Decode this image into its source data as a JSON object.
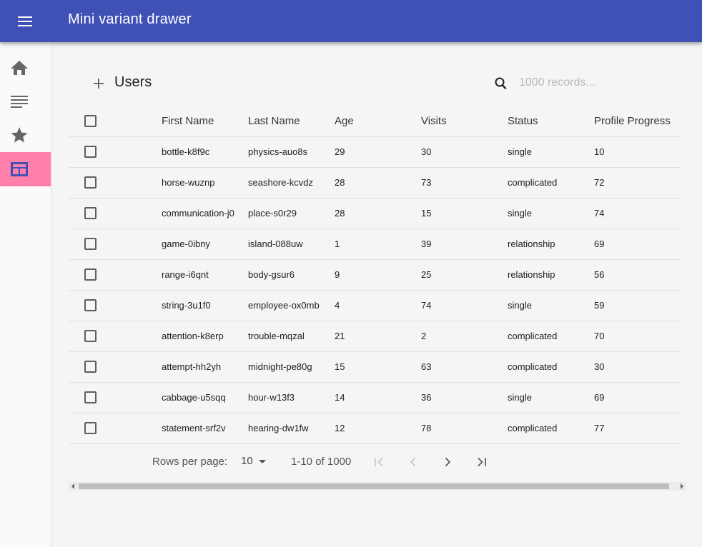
{
  "appbar": {
    "title": "Mini variant drawer",
    "menu_icon": "menu-icon"
  },
  "drawer": {
    "items": [
      {
        "icon": "home-icon",
        "selected": false
      },
      {
        "icon": "list-icon",
        "selected": false
      },
      {
        "icon": "star-icon",
        "selected": false
      },
      {
        "icon": "table-icon",
        "selected": true
      }
    ],
    "selected_color": "#ff80ab"
  },
  "table": {
    "title": "Users",
    "search_placeholder": "1000 records...",
    "columns": [
      "First Name",
      "Last Name",
      "Age",
      "Visits",
      "Status",
      "Profile Progress"
    ],
    "rows": [
      [
        "bottle-k8f9c",
        "physics-auo8s",
        "29",
        "30",
        "single",
        "10"
      ],
      [
        "horse-wuznp",
        "seashore-kcvdz",
        "28",
        "73",
        "complicated",
        "72"
      ],
      [
        "communication-j0",
        "place-s0r29",
        "28",
        "15",
        "single",
        "74"
      ],
      [
        "game-0ibny",
        "island-088uw",
        "1",
        "39",
        "relationship",
        "69"
      ],
      [
        "range-i6qnt",
        "body-gsur6",
        "9",
        "25",
        "relationship",
        "56"
      ],
      [
        "string-3u1f0",
        "employee-ox0mb",
        "4",
        "74",
        "single",
        "59"
      ],
      [
        "attention-k8erp",
        "trouble-mqzal",
        "21",
        "2",
        "complicated",
        "70"
      ],
      [
        "attempt-hh2yh",
        "midnight-pe80g",
        "15",
        "63",
        "complicated",
        "30"
      ],
      [
        "cabbage-u5sqq",
        "hour-w13f3",
        "14",
        "36",
        "single",
        "69"
      ],
      [
        "statement-srf2v",
        "hearing-dw1fw",
        "12",
        "78",
        "complicated",
        "77"
      ]
    ]
  },
  "pagination": {
    "rows_per_page_label": "Rows per page:",
    "rows_per_page": "10",
    "range": "1-10 of 1000"
  },
  "colors": {
    "primary": "#3f51b5",
    "accent": "#ff80ab"
  }
}
